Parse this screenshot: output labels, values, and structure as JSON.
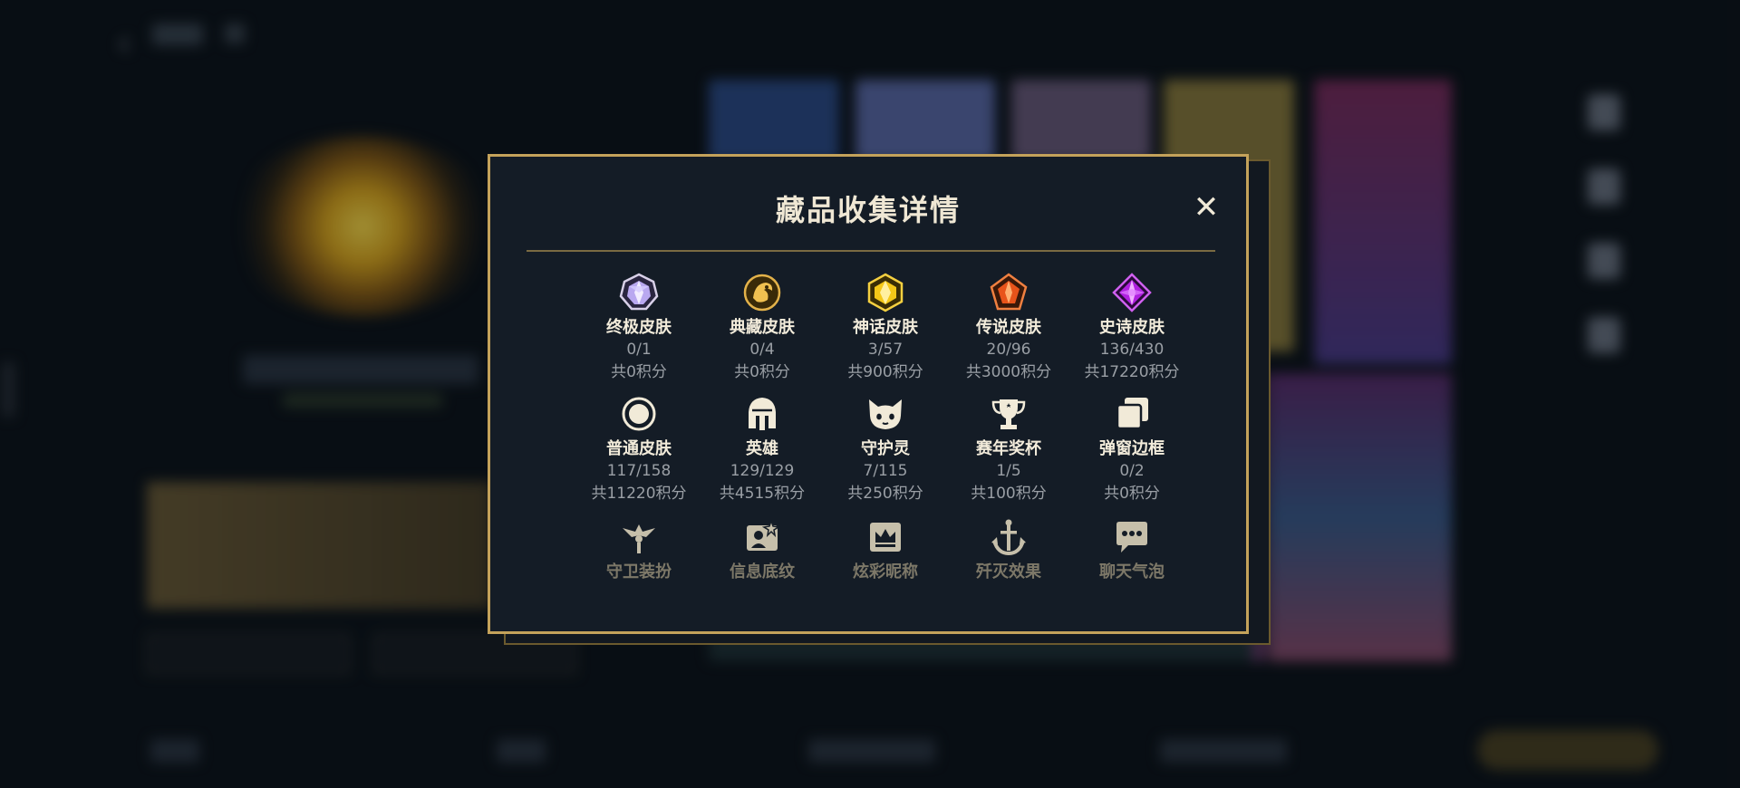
{
  "modal": {
    "title": "藏品收集详情",
    "close_label": "✕",
    "accent_color": "#c4a25a"
  },
  "categories": [
    {
      "name": "终极皮肤",
      "count": "0/1",
      "points": "共0积分",
      "icon": "ultimate-gem-icon"
    },
    {
      "name": "典藏皮肤",
      "count": "0/4",
      "points": "共0积分",
      "icon": "dragon-emblem-icon"
    },
    {
      "name": "神话皮肤",
      "count": "3/57",
      "points": "共900积分",
      "icon": "mythic-gem-icon"
    },
    {
      "name": "传说皮肤",
      "count": "20/96",
      "points": "共3000积分",
      "icon": "legendary-gem-icon"
    },
    {
      "name": "史诗皮肤",
      "count": "136/430",
      "points": "共17220积分",
      "icon": "epic-gem-icon"
    },
    {
      "name": "普通皮肤",
      "count": "117/158",
      "points": "共11220积分",
      "icon": "ring-icon"
    },
    {
      "name": "英雄",
      "count": "129/129",
      "points": "共4515积分",
      "icon": "helmet-icon"
    },
    {
      "name": "守护灵",
      "count": "7/115",
      "points": "共250积分",
      "icon": "pet-icon"
    },
    {
      "name": "赛年奖杯",
      "count": "1/5",
      "points": "共100积分",
      "icon": "trophy-icon"
    },
    {
      "name": "弹窗边框",
      "count": "0/2",
      "points": "共0积分",
      "icon": "frame-icon"
    },
    {
      "name": "守卫装扮",
      "icon": "ward-icon"
    },
    {
      "name": "信息底纹",
      "icon": "profile-card-icon"
    },
    {
      "name": "炫彩昵称",
      "icon": "crown-badge-icon"
    },
    {
      "name": "歼灭效果",
      "icon": "anchor-icon"
    },
    {
      "name": "聊天气泡",
      "icon": "chat-bubble-icon"
    }
  ]
}
